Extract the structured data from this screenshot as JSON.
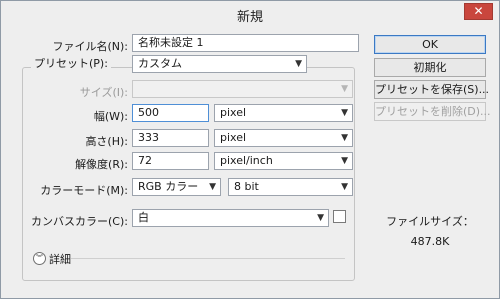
{
  "window": {
    "title": "新規",
    "close_label": "✕"
  },
  "form": {
    "filename": {
      "label": "ファイル名(N):",
      "value": "名称未設定 1"
    },
    "preset": {
      "label": "プリセット(P):",
      "value": "カスタム"
    },
    "size": {
      "label": "サイズ(I):",
      "value": "",
      "disabled": true
    },
    "width": {
      "label": "幅(W):",
      "value": "500",
      "unit": "pixel"
    },
    "height": {
      "label": "高さ(H):",
      "value": "333",
      "unit": "pixel"
    },
    "resolution": {
      "label": "解像度(R):",
      "value": "72",
      "unit": "pixel/inch"
    },
    "color_mode": {
      "label": "カラーモード(M):",
      "value": "RGB カラー",
      "depth": "8 bit"
    },
    "background": {
      "label": "カンバスカラー(C):",
      "value": "白"
    },
    "details": {
      "label": "詳細"
    }
  },
  "buttons": {
    "ok": "OK",
    "reset": "初期化",
    "save_preset": "プリセットを保存(S)...",
    "delete_preset": "プリセットを削除(D)..."
  },
  "file_size": {
    "label": "ファイルサイズ：",
    "value": "487.8K"
  },
  "icons": {
    "dropdown": "chevron-down-icon",
    "details_toggle": "double-chevron-down-icon",
    "close": "close-icon"
  },
  "colors": {
    "accent": "#3b79c4",
    "close": "#c9463d",
    "background": "#eeeeee"
  }
}
